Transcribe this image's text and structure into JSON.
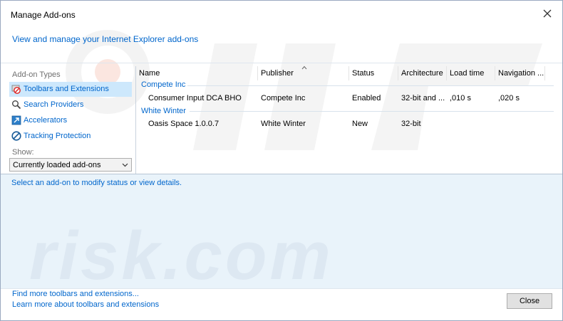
{
  "window": {
    "title": "Manage Add-ons"
  },
  "headline": "View and manage your Internet Explorer add-ons",
  "sidebar": {
    "types_label": "Add-on Types",
    "items": [
      {
        "label": "Toolbars and Extensions",
        "icon": "toolbars-extensions-icon",
        "selected": true
      },
      {
        "label": "Search Providers",
        "icon": "search-icon"
      },
      {
        "label": "Accelerators",
        "icon": "accelerator-icon"
      },
      {
        "label": "Tracking Protection",
        "icon": "tracking-protection-icon"
      }
    ],
    "show_label": "Show:",
    "show_value": "Currently loaded add-ons"
  },
  "table": {
    "columns": [
      "Name",
      "Publisher",
      "Status",
      "Architecture",
      "Load time",
      "Navigation ..."
    ],
    "groups": [
      {
        "name": "Compete Inc",
        "rows": [
          {
            "name": "Consumer Input DCA BHO",
            "publisher": "Compete Inc",
            "status": "Enabled",
            "architecture": "32-bit and ...",
            "load_time": ",010 s",
            "navigation": ",020 s"
          }
        ]
      },
      {
        "name": "White Winter",
        "rows": [
          {
            "name": "Oasis Space 1.0.0.7",
            "publisher": "White Winter",
            "status": "New",
            "architecture": "32-bit",
            "load_time": "",
            "navigation": ""
          }
        ]
      }
    ]
  },
  "details": {
    "prompt": "Select an add-on to modify status or view details."
  },
  "footer": {
    "link_find": "Find more toolbars and extensions...",
    "link_learn": "Learn more about toolbars and extensions",
    "close_label": "Close"
  },
  "colors": {
    "link": "#0066cc",
    "selected": "#cde8fc",
    "details_bg": "#e9f3fa"
  }
}
